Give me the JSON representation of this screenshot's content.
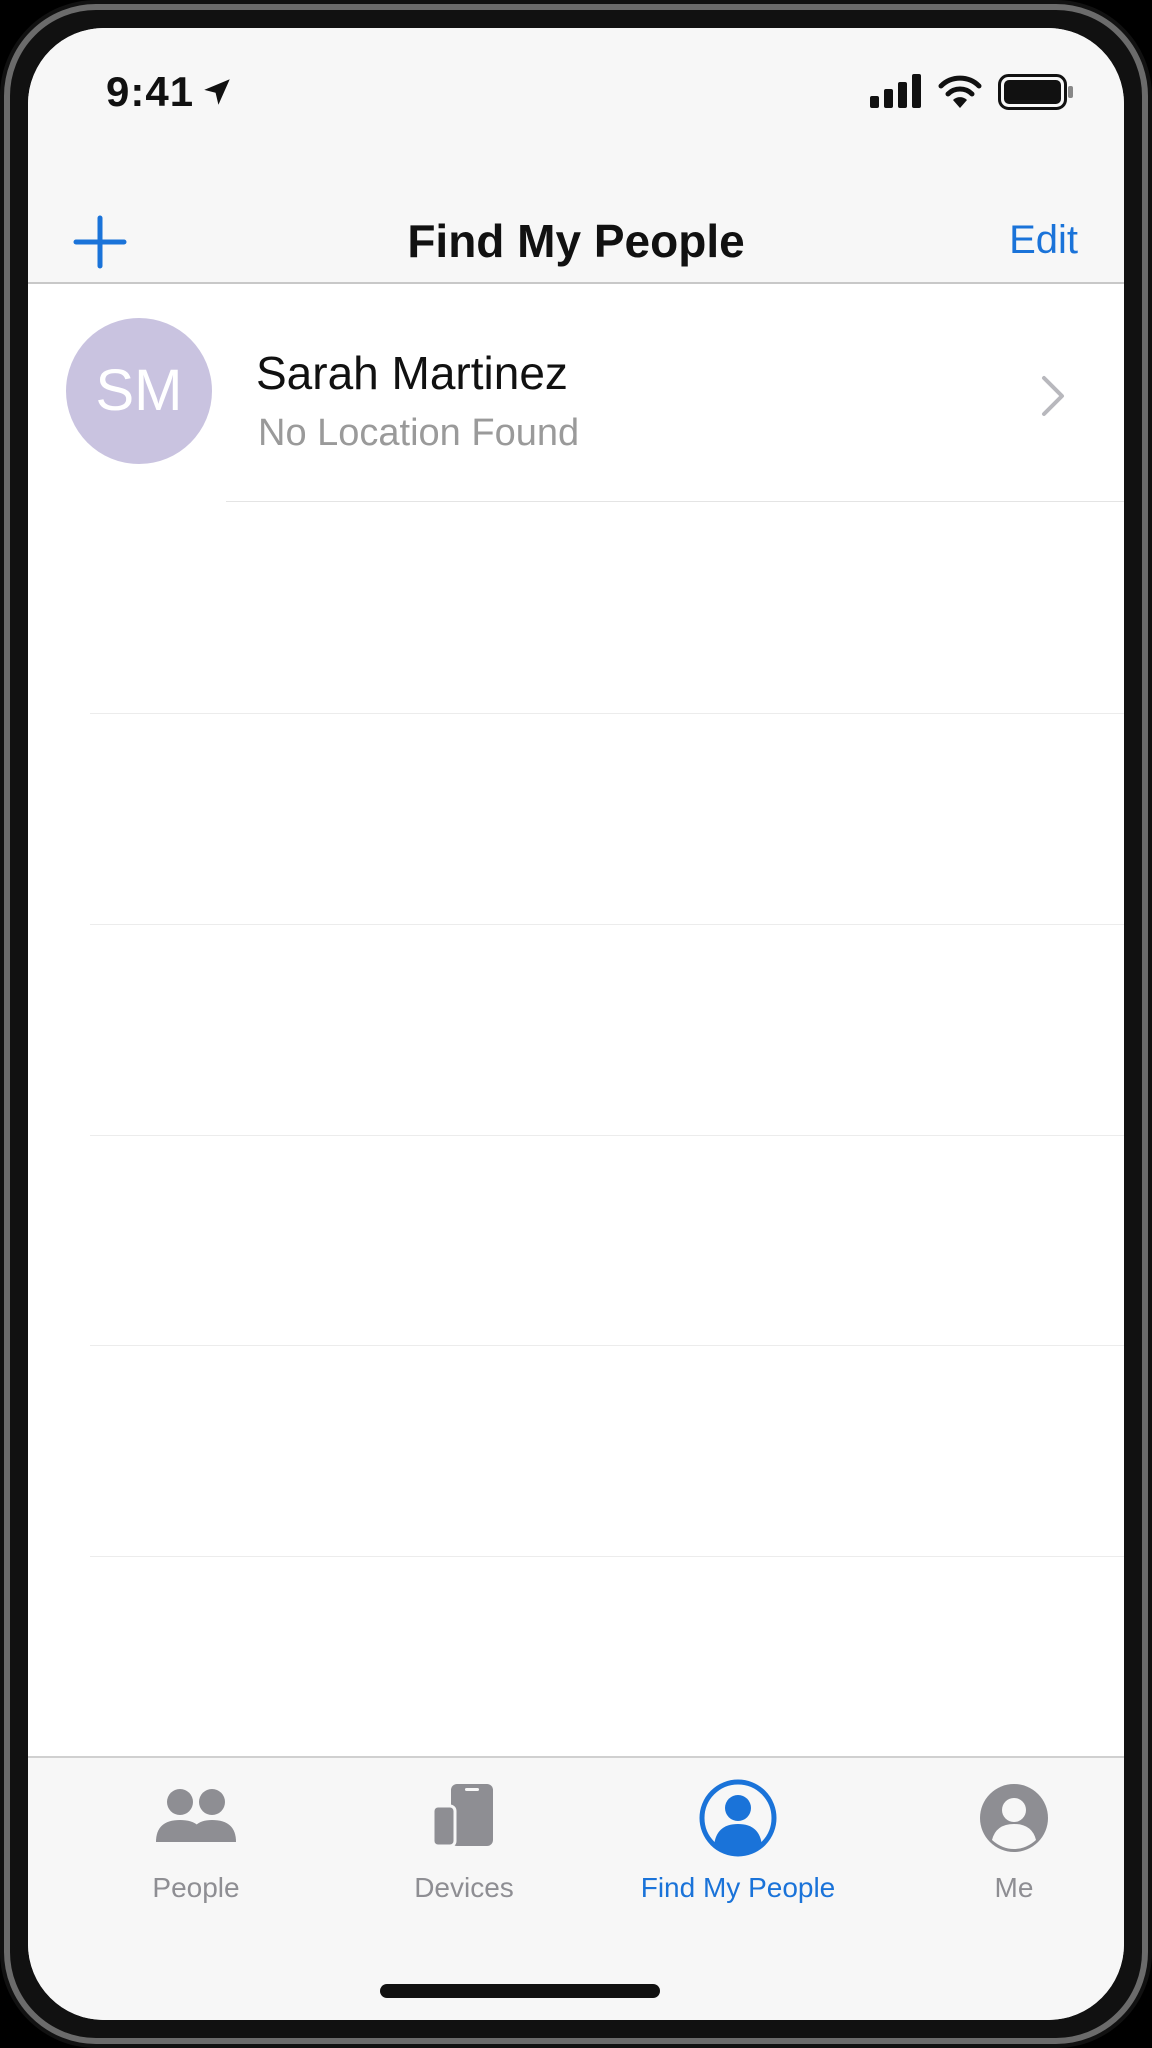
{
  "status_bar": {
    "time": "9:41"
  },
  "nav": {
    "title": "Find My People",
    "edit_label": "Edit"
  },
  "people": [
    {
      "initials": "SM",
      "name": "Sarah Martinez",
      "status": "No Location Found",
      "avatar_color": "#c9c3e0"
    }
  ],
  "tabs": [
    {
      "label": "People",
      "icon": "people-icon",
      "active": false
    },
    {
      "label": "Devices",
      "icon": "devices-icon",
      "active": false
    },
    {
      "label": "Find My People",
      "icon": "person-circle-icon",
      "active": true
    },
    {
      "label": "Me",
      "icon": "me-icon",
      "active": false
    }
  ],
  "colors": {
    "accent": "#1a73d9",
    "inactive": "#8e8e93"
  }
}
